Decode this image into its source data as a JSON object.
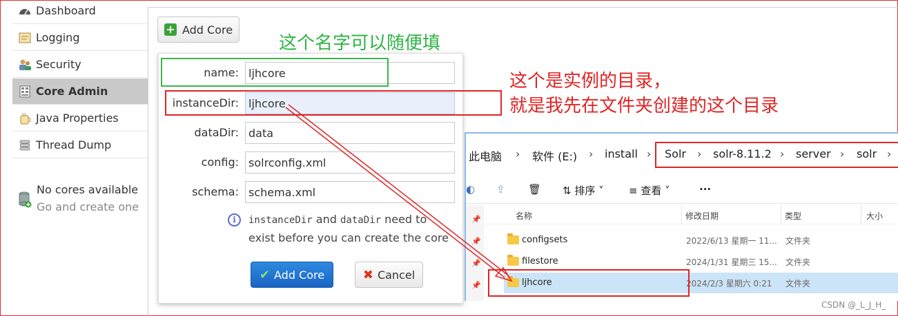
{
  "sidebar": {
    "items": [
      {
        "label": "Dashboard",
        "icon": "dashboard-icon"
      },
      {
        "label": "Logging",
        "icon": "logging-icon"
      },
      {
        "label": "Security",
        "icon": "security-icon"
      },
      {
        "label": "Core Admin",
        "icon": "core-admin-icon",
        "active": true
      },
      {
        "label": "Java Properties",
        "icon": "java-icon"
      },
      {
        "label": "Thread Dump",
        "icon": "thread-dump-icon"
      }
    ],
    "no_cores": {
      "title": "No cores available",
      "subtitle": "Go and create one"
    }
  },
  "toolbar": {
    "add_core_label": "Add Core"
  },
  "form": {
    "fields": [
      {
        "label": "name:",
        "value": "ljhcore"
      },
      {
        "label": "instanceDir:",
        "value": "ljhcore"
      },
      {
        "label": "dataDir:",
        "value": "data"
      },
      {
        "label": "config:",
        "value": "solrconfig.xml"
      },
      {
        "label": "schema:",
        "value": "schema.xml"
      }
    ],
    "info": {
      "part1": "instanceDir",
      "part2": " and ",
      "part3": "dataDir",
      "part4": " need to exist before you can create the core"
    },
    "submit_label": "Add Core",
    "cancel_label": "Cancel"
  },
  "annotations": {
    "green_note": "这个名字可以随便填",
    "red_note_line1": "这个是实例的目录，",
    "red_note_line2": "就是我先在文件夹创建的这个目录"
  },
  "explorer": {
    "breadcrumb": [
      "此电脑",
      "软件 (E:)",
      "install",
      "Solr",
      "solr-8.11.2",
      "server",
      "solr"
    ],
    "toolbar": {
      "sort": "排序",
      "view": "查看",
      "more": "···"
    },
    "columns": {
      "name": "名称",
      "date": "修改日期",
      "type": "类型",
      "size": "大小"
    },
    "rows": [
      {
        "name": "configsets",
        "date": "2022/6/13  星期一 11...",
        "type": "文件夹"
      },
      {
        "name": "filestore",
        "date": "2024/1/31  星期三 15...",
        "type": "文件夹"
      },
      {
        "name": "ljhcore",
        "date": "2024/2/3  星期六 0:21",
        "type": "文件夹",
        "selected": true
      }
    ]
  },
  "watermark": "CSDN @_L_J_H_",
  "colors": {
    "green": "#3cb54a",
    "red": "#e02424",
    "primary": "#1a64c4"
  }
}
